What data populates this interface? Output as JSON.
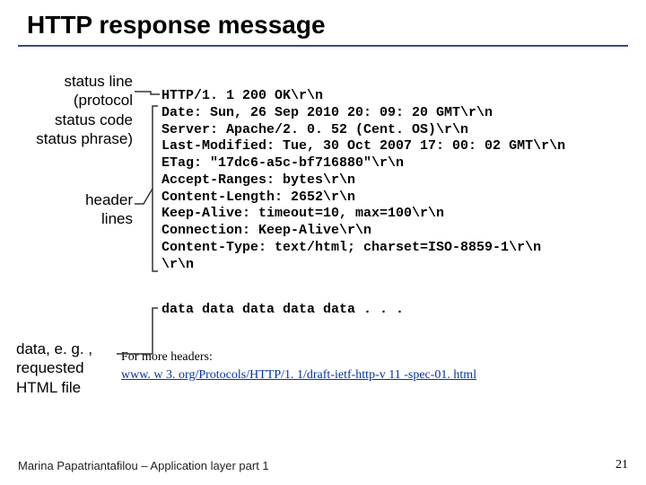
{
  "title": "HTTP response message",
  "annotations": {
    "status": "status line\n(protocol\nstatus code\nstatus phrase)",
    "headers": "header\nlines",
    "data": "data, e. g. , \nrequested\nHTML file"
  },
  "lines": [
    "HTTP/1. 1 200 OK\\r\\n",
    "Date: Sun, 26 Sep 2010 20: 09: 20 GMT\\r\\n",
    "Server: Apache/2. 0. 52 (Cent. OS)\\r\\n",
    "Last-Modified: Tue, 30 Oct 2007 17: 00: 02 GMT\\r\\n",
    "ETag: \"17dc6-a5c-bf716880\"\\r\\n",
    "Accept-Ranges: bytes\\r\\n",
    "Content-Length: 2652\\r\\n",
    "Keep-Alive: timeout=10, max=100\\r\\n",
    "Connection: Keep-Alive\\r\\n",
    "Content-Type: text/html; charset=ISO-8859-1\\r\\n",
    "\\r\\n"
  ],
  "data_line": "data data data data data . . . ",
  "more_label": "For more headers:",
  "more_link": "www. w 3. org/Protocols/HTTP/1. 1/draft-ietf-http-v 11 -spec-01. html",
  "footer": "Marina Papatriantafilou – Application layer part 1",
  "slide_number": "21"
}
